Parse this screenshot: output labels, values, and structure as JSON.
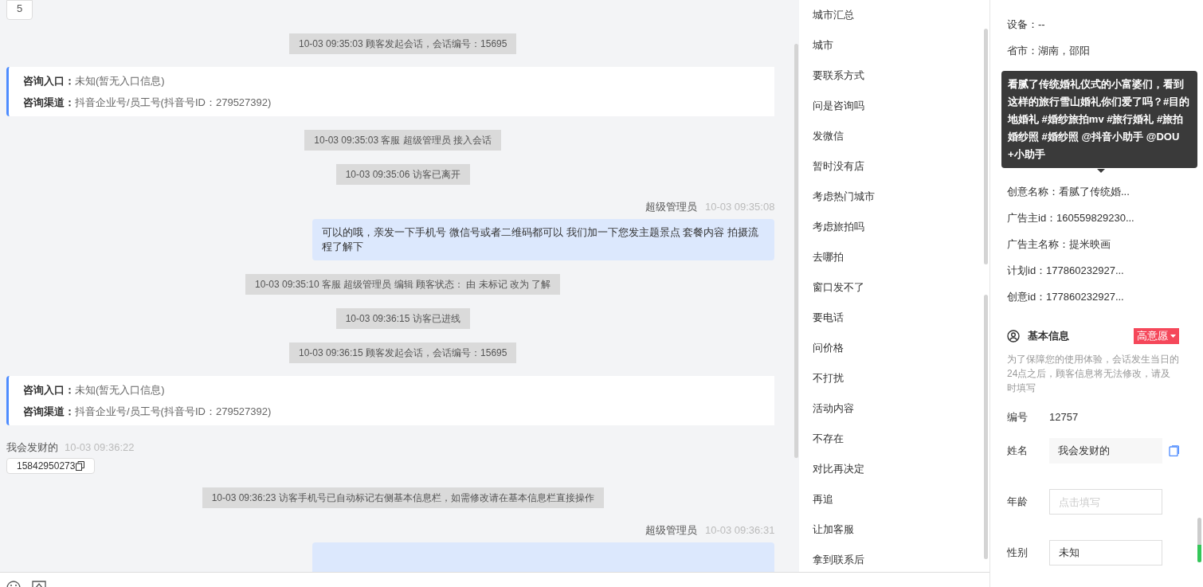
{
  "chat": {
    "top_badge": "5",
    "messages": [
      {
        "kind": "system",
        "text": "10-03 09:35:03 顾客发起会话，会话编号：15695"
      },
      {
        "kind": "entry",
        "lines": [
          {
            "label": "咨询入口：",
            "value": "未知(暂无入口信息)"
          },
          {
            "label": "咨询渠道：",
            "value": "抖音企业号/员工号(抖音号ID：279527392)"
          }
        ]
      },
      {
        "kind": "system",
        "text": "10-03 09:35:03 客服 超级管理员 接入会话"
      },
      {
        "kind": "system",
        "text": "10-03 09:35:06 访客已离开"
      },
      {
        "kind": "agent",
        "sender": "超级管理员",
        "time": "10-03 09:35:08",
        "text": "可以的哦，亲发一下手机号 微信号或者二维码都可以 我们加一下您发主题景点 套餐内容 拍摄流程了解下"
      },
      {
        "kind": "system",
        "text": "10-03 09:35:10 客服 超级管理员 编辑 顾客状态： 由 未标记 改为 了解"
      },
      {
        "kind": "system",
        "text": "10-03 09:36:15 访客已进线"
      },
      {
        "kind": "system",
        "text": "10-03 09:36:15 顾客发起会话，会话编号：15695"
      },
      {
        "kind": "entry",
        "lines": [
          {
            "label": "咨询入口：",
            "value": "未知(暂无入口信息)"
          },
          {
            "label": "咨询渠道：",
            "value": "抖音企业号/员工号(抖音号ID：279527392)"
          }
        ]
      },
      {
        "kind": "visitor",
        "sender": "我会发财的",
        "time": "10-03 09:36:22",
        "text": "15842950273"
      },
      {
        "kind": "system",
        "text": "10-03 09:36:23 访客手机号已自动标记右侧基本信息栏，如需修改请在基本信息栏直接操作"
      },
      {
        "kind": "agent",
        "sender": "超级管理员",
        "time": "10-03 09:36:31"
      }
    ]
  },
  "quick_replies": [
    "城市汇总",
    "城市",
    "要联系方式",
    "问是咨询吗",
    "发微信",
    "暂时没有店",
    "考虑热门城市",
    "考虑旅拍吗",
    "去哪拍",
    "窗口发不了",
    "要电话",
    "问价格",
    "不打扰",
    "活动内容",
    "不存在",
    "对比再决定",
    "再追",
    "让加客服",
    "拿到联系后"
  ],
  "details": {
    "rows_top": [
      "设备：--",
      "省市：湖南，邵阳"
    ],
    "rows_bottom": [
      "创意名称：看腻了传统婚...",
      "广告主id：160559829230...",
      "广告主名称：提米映画",
      "计划id：177860232927...",
      "创意id：177860232927..."
    ],
    "tooltip": "看腻了传统婚礼仪式的小富婆们，看到这样的旅行雪山婚礼你们爱了吗？#目的地婚礼 #婚纱旅拍mv #旅行婚礼 #旅拍婚纱照 #婚纱照 @抖音小助手 @DOU+小助手"
  },
  "basic_info": {
    "title": "基本信息",
    "intent_tag": "高意愿",
    "notice": "为了保障您的使用体验，会话发生当日的24点之后，顾客信息将无法修改，请及时填写",
    "fields": [
      {
        "kind": "text",
        "label": "编号",
        "value": "12757"
      },
      {
        "kind": "readonly",
        "label": "姓名",
        "value": "我会发财的"
      },
      {
        "kind": "input",
        "label": "年龄",
        "placeholder": "点击填写"
      },
      {
        "kind": "input",
        "label": "性别",
        "value": "未知"
      }
    ]
  }
}
